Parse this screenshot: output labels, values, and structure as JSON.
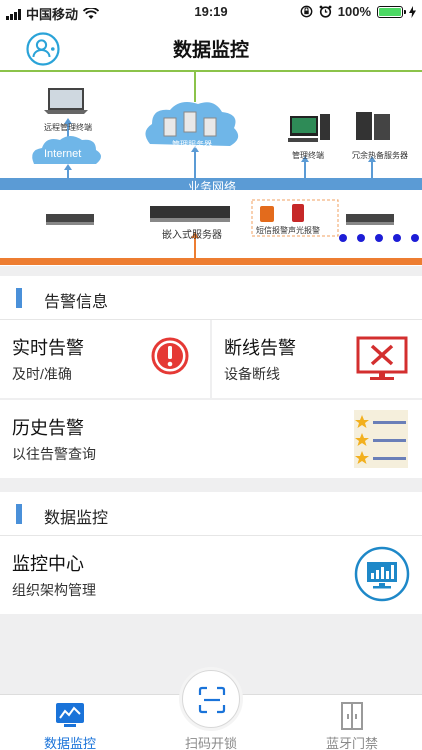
{
  "status_bar": {
    "carrier": "中国移动",
    "time": "19:19",
    "battery": "100%",
    "icons": [
      "signal-icon",
      "wifi-icon",
      "rotation-lock-icon",
      "alarm-icon",
      "battery-icon",
      "charging-icon"
    ]
  },
  "nav": {
    "title": "数据监控",
    "avatar_icon": "user-avatar-icon"
  },
  "diagram": {
    "labels": {
      "remote_terminal": "远程管理终端",
      "internet": "Internet",
      "management_server": "管理服务器",
      "management_terminal": "管理终端",
      "redundant_server": "冗余热备服务器",
      "business_network": "业务网络",
      "embedded_server": "嵌入式服务器",
      "sms_alarm": "短信报警",
      "sound_light_alarm": "声光报警"
    },
    "colors": {
      "network_band": "#5b9bd5",
      "bottom_band": "#ed7d31",
      "top_line": "#8bc34a",
      "dots": "#1d1dd6"
    }
  },
  "alarm_section": {
    "header": "告警信息",
    "cards": [
      {
        "title": "实时告警",
        "subtitle": "及时/准确",
        "icon": "exclamation-alert-icon"
      },
      {
        "title": "断线告警",
        "subtitle": "设备断线",
        "icon": "monitor-disconnect-icon"
      },
      {
        "title": "历史告警",
        "subtitle": "以往告警查询",
        "icon": "star-list-icon"
      }
    ]
  },
  "monitor_section": {
    "header": "数据监控",
    "cards": [
      {
        "title": "监控中心",
        "subtitle": "组织架构管理",
        "icon": "chart-monitor-icon"
      }
    ]
  },
  "tabbar": {
    "tabs": [
      {
        "label": "数据监控",
        "icon": "data-monitor-icon",
        "active": true
      },
      {
        "label": "扫码开锁",
        "icon": "scan-icon",
        "active": false
      },
      {
        "label": "蓝牙门禁",
        "icon": "door-icon",
        "active": false
      }
    ],
    "active_color": "#1a73d9",
    "inactive_color": "#8a8a8a"
  }
}
